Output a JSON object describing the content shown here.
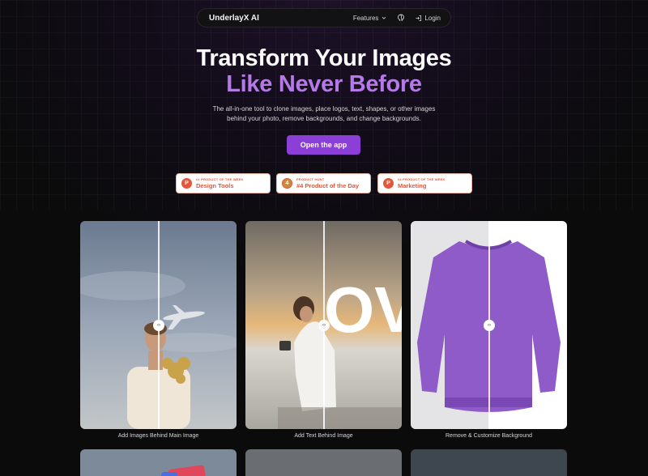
{
  "nav": {
    "brand": "UnderlayX AI",
    "features_label": "Features",
    "login_label": "Login"
  },
  "hero": {
    "title_line1": "Transform Your Images",
    "title_line2": "Like Never Before",
    "subtitle": "The all-in-one tool to clone images, place logos, text, shapes, or other images behind your photo, remove backgrounds, and change backgrounds.",
    "cta_label": "Open the app"
  },
  "badges": [
    {
      "small": "#1 PRODUCT OF THE WEEK",
      "big": "Design Tools",
      "logo": "P",
      "icon": "producthunt-icon"
    },
    {
      "small": "PRODUCT HUNT",
      "big": "#4 Product of the Day",
      "logo": "4",
      "icon": "medal-icon"
    },
    {
      "small": "#4 PRODUCT OF THE WEEK",
      "big": "Marketing",
      "logo": "P",
      "icon": "producthunt-icon"
    }
  ],
  "cards": [
    {
      "caption": "Add Images Behind Main Image"
    },
    {
      "caption": "Add Text Behind Image",
      "overlay_text": "OV"
    },
    {
      "caption": "Remove & Customize Background"
    }
  ],
  "colors": {
    "accent": "#b57ae8",
    "cta": "#8b3fd6",
    "badge_text": "#e2573b",
    "background": "#0b0b0c"
  }
}
